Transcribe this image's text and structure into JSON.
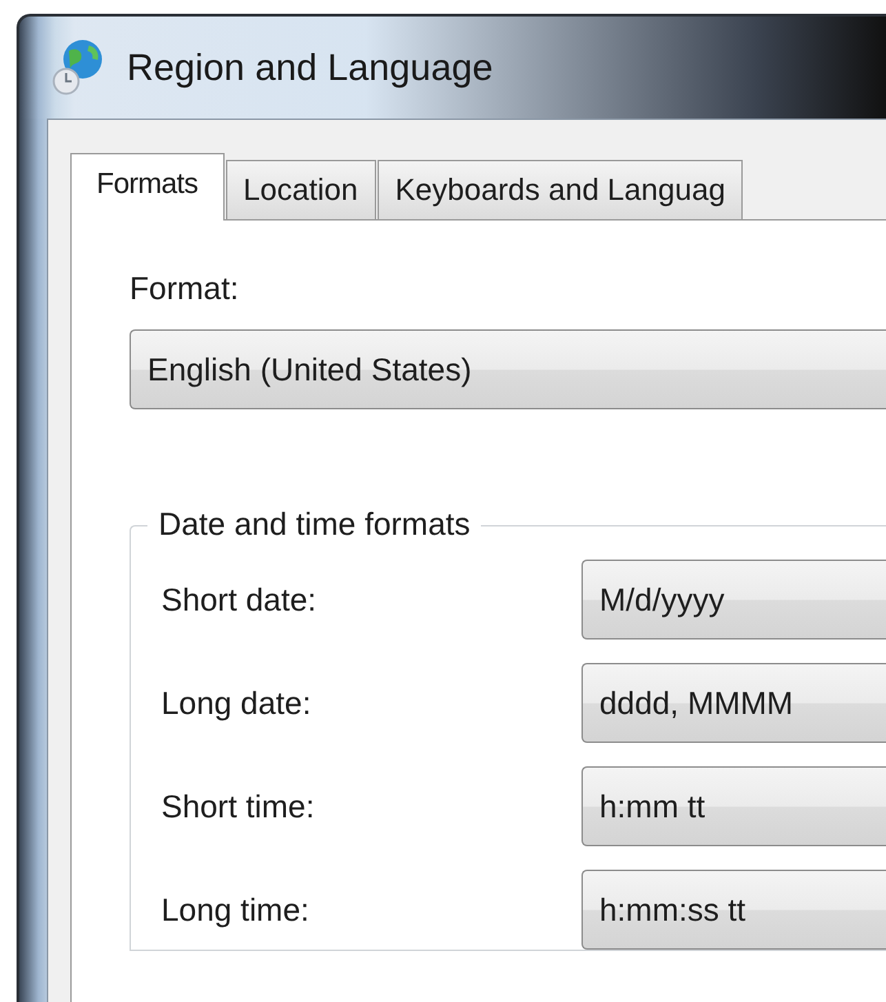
{
  "window": {
    "title": "Region and Language"
  },
  "tabs": [
    {
      "label": "Formats",
      "selected": true
    },
    {
      "label": "Location",
      "selected": false
    },
    {
      "label": "Keyboards and Languag",
      "selected": false
    }
  ],
  "format": {
    "label": "Format:",
    "value": "English (United States)"
  },
  "date_time_formats": {
    "title": "Date and time formats",
    "rows": [
      {
        "label": "Short date:",
        "value": "M/d/yyyy"
      },
      {
        "label": "Long date:",
        "value": "dddd, MMMM"
      },
      {
        "label": "Short time:",
        "value": "h:mm tt"
      },
      {
        "label": "Long time:",
        "value": "h:mm:ss tt"
      }
    ]
  }
}
